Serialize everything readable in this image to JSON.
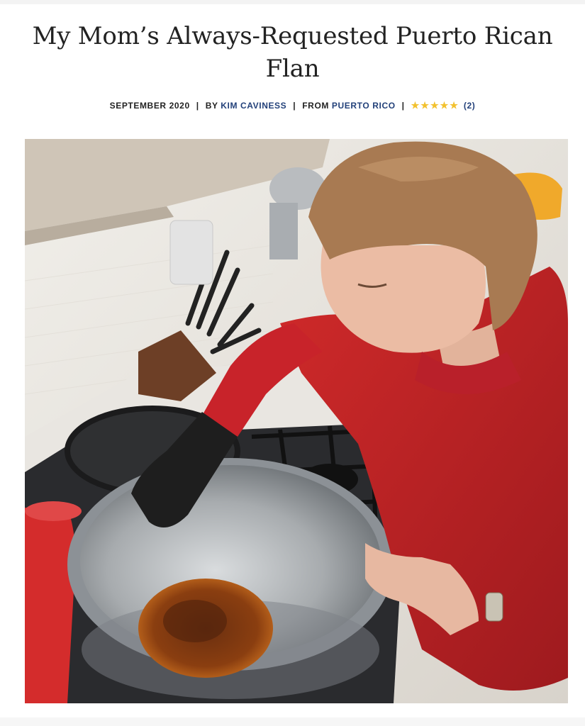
{
  "article": {
    "title": "My Mom’s Always-Requested Puerto Rican Flan",
    "date": "SEPTEMBER 2020",
    "by_prefix": "BY",
    "author": "KIM CAVINESS",
    "from_prefix": "FROM",
    "origin": "PUERTO RICO",
    "rating": {
      "stars": 5,
      "max": 5,
      "review_count": "(2)"
    },
    "separator": "|"
  },
  "photo": {
    "subject": "woman in red sweater pouring caramel into steel bowl over stove"
  },
  "colors": {
    "link": "#23417a",
    "star": "#f2c12e",
    "text": "#222222"
  }
}
